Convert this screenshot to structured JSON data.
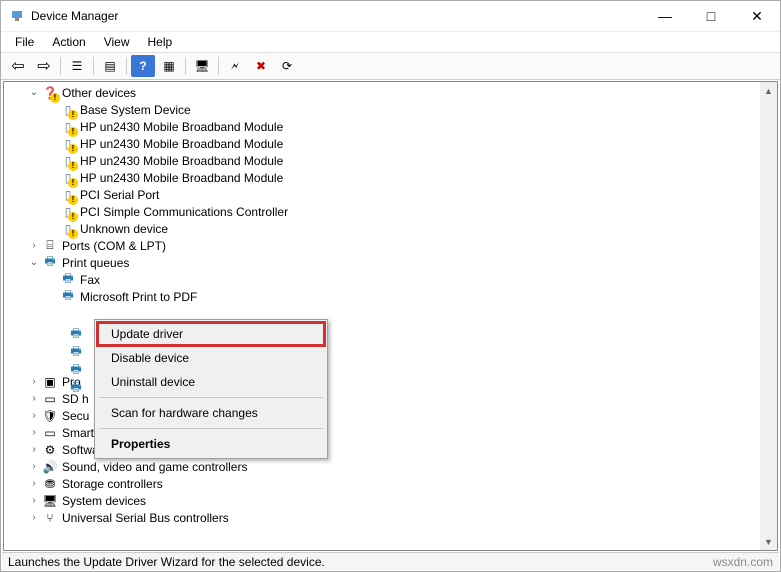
{
  "window": {
    "title": "Device Manager",
    "controls": {
      "minimize": "—",
      "maximize": "□",
      "close": "✕"
    }
  },
  "menubar": [
    "File",
    "Action",
    "View",
    "Help"
  ],
  "toolbar": {
    "items": [
      {
        "name": "back-icon",
        "glyph": "⇦"
      },
      {
        "name": "forward-icon",
        "glyph": "⇨"
      },
      {
        "name": "sep"
      },
      {
        "name": "show-hide-tree-icon",
        "glyph": "☰"
      },
      {
        "name": "sep"
      },
      {
        "name": "properties-icon",
        "glyph": "▤"
      },
      {
        "name": "sep"
      },
      {
        "name": "help-icon",
        "glyph": "?"
      },
      {
        "name": "details-icon",
        "glyph": "▦"
      },
      {
        "name": "sep"
      },
      {
        "name": "monitor-icon",
        "glyph": "🖥"
      },
      {
        "name": "sep"
      },
      {
        "name": "scan-hardware-icon",
        "glyph": "🗲"
      },
      {
        "name": "uninstall-icon",
        "glyph": "✖"
      },
      {
        "name": "update-driver-icon",
        "glyph": "⟳"
      }
    ]
  },
  "tree": [
    {
      "level": 1,
      "expander": "open",
      "icon": "question-icon",
      "warning": true,
      "label": "Other devices"
    },
    {
      "level": 2,
      "icon": "chip-icon",
      "warning": true,
      "label": "Base System Device"
    },
    {
      "level": 2,
      "icon": "chip-icon",
      "warning": true,
      "label": "HP un2430 Mobile Broadband Module"
    },
    {
      "level": 2,
      "icon": "chip-icon",
      "warning": true,
      "label": "HP un2430 Mobile Broadband Module"
    },
    {
      "level": 2,
      "icon": "chip-icon",
      "warning": true,
      "label": "HP un2430 Mobile Broadband Module"
    },
    {
      "level": 2,
      "icon": "chip-icon",
      "warning": true,
      "label": "HP un2430 Mobile Broadband Module"
    },
    {
      "level": 2,
      "icon": "chip-icon",
      "warning": true,
      "label": "PCI Serial Port"
    },
    {
      "level": 2,
      "icon": "chip-icon",
      "warning": true,
      "label": "PCI Simple Communications Controller"
    },
    {
      "level": 2,
      "icon": "chip-icon",
      "warning": true,
      "label": "Unknown device"
    },
    {
      "level": 1,
      "expander": "closed",
      "icon": "port-icon",
      "label": "Ports (COM & LPT)"
    },
    {
      "level": 1,
      "expander": "open",
      "icon": "printer-icon",
      "label": "Print queues"
    },
    {
      "level": 2,
      "icon": "printer-icon",
      "label": "Fax"
    },
    {
      "level": 2,
      "icon": "printer-icon",
      "label": "Microsoft Print to PDF"
    },
    {
      "level": 1,
      "expander": "closed",
      "icon": "cpu-icon",
      "label": "Pro",
      "cut": true
    },
    {
      "level": 1,
      "expander": "closed",
      "icon": "sd-icon",
      "label": "SD h",
      "cut": true
    },
    {
      "level": 1,
      "expander": "closed",
      "icon": "shield-icon",
      "label": "Secu",
      "cut": true
    },
    {
      "level": 1,
      "expander": "closed",
      "icon": "card-icon",
      "label": "Smart card readers"
    },
    {
      "level": 1,
      "expander": "closed",
      "icon": "soft-icon",
      "label": "Software devices"
    },
    {
      "level": 1,
      "expander": "closed",
      "icon": "sound-icon",
      "label": "Sound, video and game controllers"
    },
    {
      "level": 1,
      "expander": "closed",
      "icon": "storage-icon",
      "label": "Storage controllers"
    },
    {
      "level": 1,
      "expander": "closed",
      "icon": "system-icon",
      "label": "System devices"
    },
    {
      "level": 1,
      "expander": "closed",
      "icon": "usb-icon",
      "label": "Universal Serial Bus controllers",
      "partial": true
    }
  ],
  "hidden_printer_rows": 4,
  "context_menu": {
    "items": [
      {
        "label": "Update driver",
        "highlighted": true
      },
      {
        "label": "Disable device"
      },
      {
        "label": "Uninstall device"
      },
      {
        "sep": true
      },
      {
        "label": "Scan for hardware changes"
      },
      {
        "sep": true
      },
      {
        "label": "Properties",
        "bold": true
      }
    ]
  },
  "statusbar": {
    "text": "Launches the Update Driver Wizard for the selected device.",
    "credit": "wsxdn.com"
  },
  "icon_glyphs": {
    "question-icon": "❓",
    "chip-icon": "▯",
    "port-icon": "⌸",
    "printer-icon": "🖶",
    "cpu-icon": "▣",
    "sd-icon": "▭",
    "shield-icon": "🛡",
    "card-icon": "▭",
    "soft-icon": "⚙",
    "sound-icon": "🔊",
    "storage-icon": "⛃",
    "system-icon": "🖥",
    "usb-icon": "⑂"
  }
}
